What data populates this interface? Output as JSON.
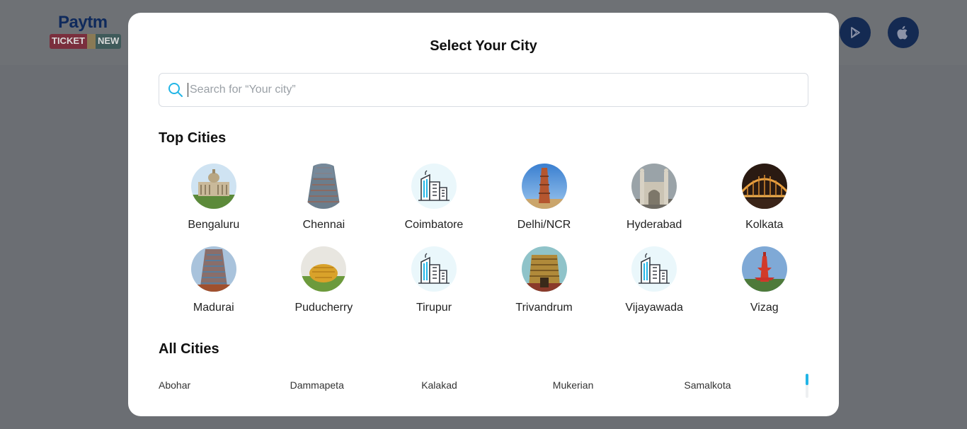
{
  "header": {
    "logo_text_top": "Paytm",
    "logo_text_left": "TICKET",
    "logo_text_right": "NEW",
    "play_store_icon": "play-store-icon",
    "app_store_icon": "apple-icon"
  },
  "modal": {
    "title": "Select Your City",
    "search": {
      "placeholder": "Search for “Your city”",
      "value": "",
      "icon": "search-icon",
      "icon_color": "#22b5e6"
    },
    "top_cities_title": "Top Cities",
    "top_cities": [
      {
        "label": "Bengaluru",
        "image": "vidhana-soudha-photo"
      },
      {
        "label": "Chennai",
        "image": "temple-gopuram-photo"
      },
      {
        "label": "Coimbatore",
        "image": "buildings-icon"
      },
      {
        "label": "Delhi/NCR",
        "image": "qutub-minar-photo"
      },
      {
        "label": "Hyderabad",
        "image": "charminar-photo"
      },
      {
        "label": "Kolkata",
        "image": "howrah-bridge-photo"
      },
      {
        "label": "Madurai",
        "image": "temple-tower-photo"
      },
      {
        "label": "Puducherry",
        "image": "matrimandir-photo"
      },
      {
        "label": "Tirupur",
        "image": "buildings-icon"
      },
      {
        "label": "Trivandrum",
        "image": "padmanabhaswamy-temple-photo"
      },
      {
        "label": "Vijayawada",
        "image": "buildings-icon"
      },
      {
        "label": "Vizag",
        "image": "lighthouse-photo"
      }
    ],
    "all_cities_title": "All Cities",
    "all_cities": [
      "Abohar",
      "Dammapeta",
      "Kalakad",
      "Mukerian",
      "Samalkota"
    ]
  },
  "colors": {
    "accent": "#22b5e6",
    "overlay": "#6b6e73",
    "store_button": "#142a52"
  }
}
